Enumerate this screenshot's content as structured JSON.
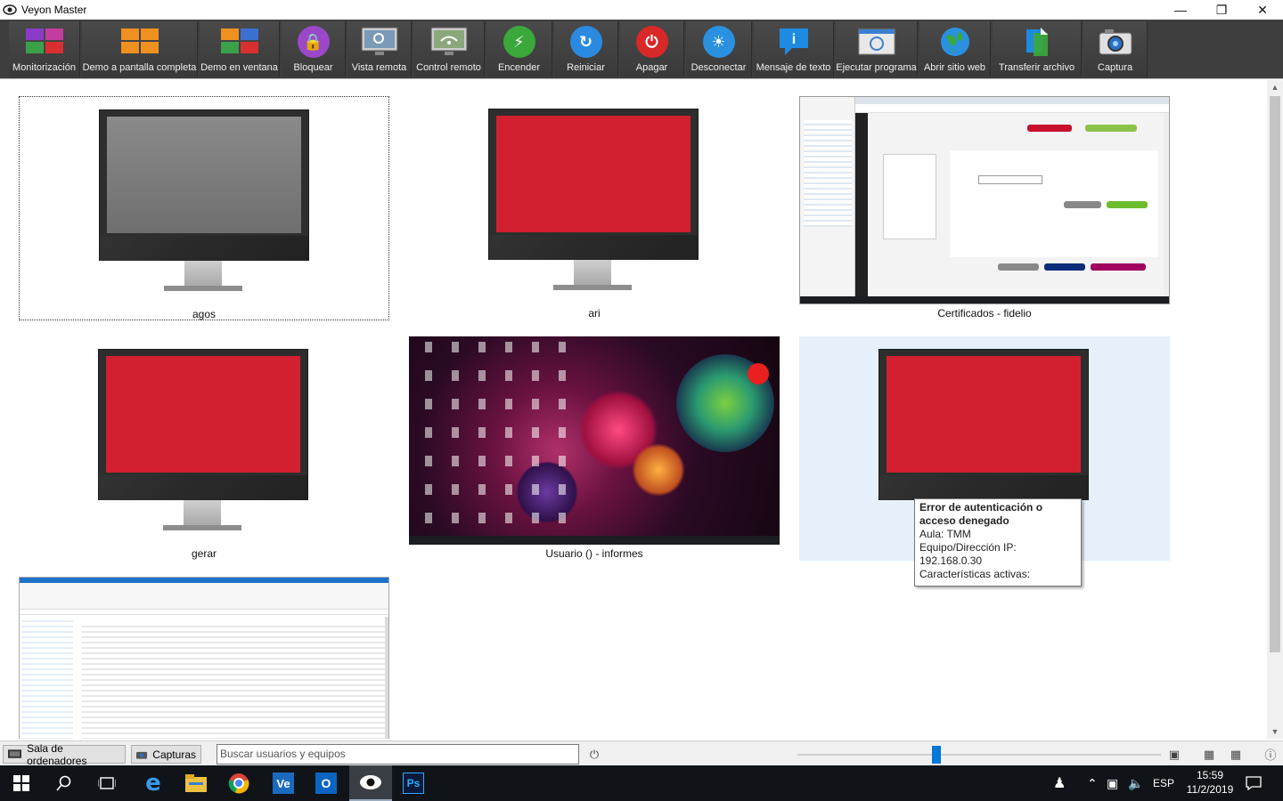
{
  "window": {
    "title": "Veyon Master",
    "minimize": "—",
    "maximize": "❐",
    "close": "✕"
  },
  "toolbar": {
    "buttons": [
      {
        "label": "Monitorización",
        "icon": "monitoring-icon"
      },
      {
        "label": "Demo a pantalla completa",
        "icon": "fullscreen-demo-icon"
      },
      {
        "label": "Demo en ventana",
        "icon": "window-demo-icon"
      },
      {
        "label": "Bloquear",
        "icon": "lock-icon"
      },
      {
        "label": "Vista remota",
        "icon": "remote-view-icon"
      },
      {
        "label": "Control remoto",
        "icon": "remote-control-icon"
      },
      {
        "label": "Encender",
        "icon": "power-on-icon"
      },
      {
        "label": "Reiniciar",
        "icon": "reboot-icon"
      },
      {
        "label": "Apagar",
        "icon": "power-off-icon"
      },
      {
        "label": "Desconectar",
        "icon": "logout-icon"
      },
      {
        "label": "Mensaje de texto",
        "icon": "text-message-icon"
      },
      {
        "label": "Ejecutar programa",
        "icon": "run-program-icon"
      },
      {
        "label": "Abrir sitio web",
        "icon": "open-website-icon"
      },
      {
        "label": "Transferir archivo",
        "icon": "file-transfer-icon"
      },
      {
        "label": "Captura",
        "icon": "screenshot-icon"
      }
    ]
  },
  "computers": [
    {
      "name": "agos",
      "state": "gray-screen",
      "selected": true
    },
    {
      "name": "ari",
      "state": "red-screen"
    },
    {
      "name": "Certificados - fidelio",
      "state": "live-browser"
    },
    {
      "name": "gerar",
      "state": "red-screen"
    },
    {
      "name": "Usuario () - informes",
      "state": "live-desktop"
    },
    {
      "name": "",
      "state": "red-screen",
      "hovered": true
    },
    {
      "name": "",
      "state": "live-explorer"
    }
  ],
  "tooltip": {
    "title": "Error de autenticación o acceso denegado",
    "room": "Aula: TMM",
    "ip": "Equipo/Dirección IP: 192.168.0.30",
    "features": "Características activas:"
  },
  "statusbar": {
    "room_button": "Sala de ordenadores",
    "screenshots_button": "Capturas",
    "search_placeholder": "Buscar usuarios y equipos",
    "zoom_percent": 38
  },
  "taskbar": {
    "time": "15:59",
    "date": "11/2/2019",
    "lang": "ESP"
  },
  "colors": {
    "toolbar_bg": "#3e3e3e",
    "error_screen": "#d22030",
    "hover_bg": "#e5f0fa",
    "taskbar_bg": "#101418"
  }
}
